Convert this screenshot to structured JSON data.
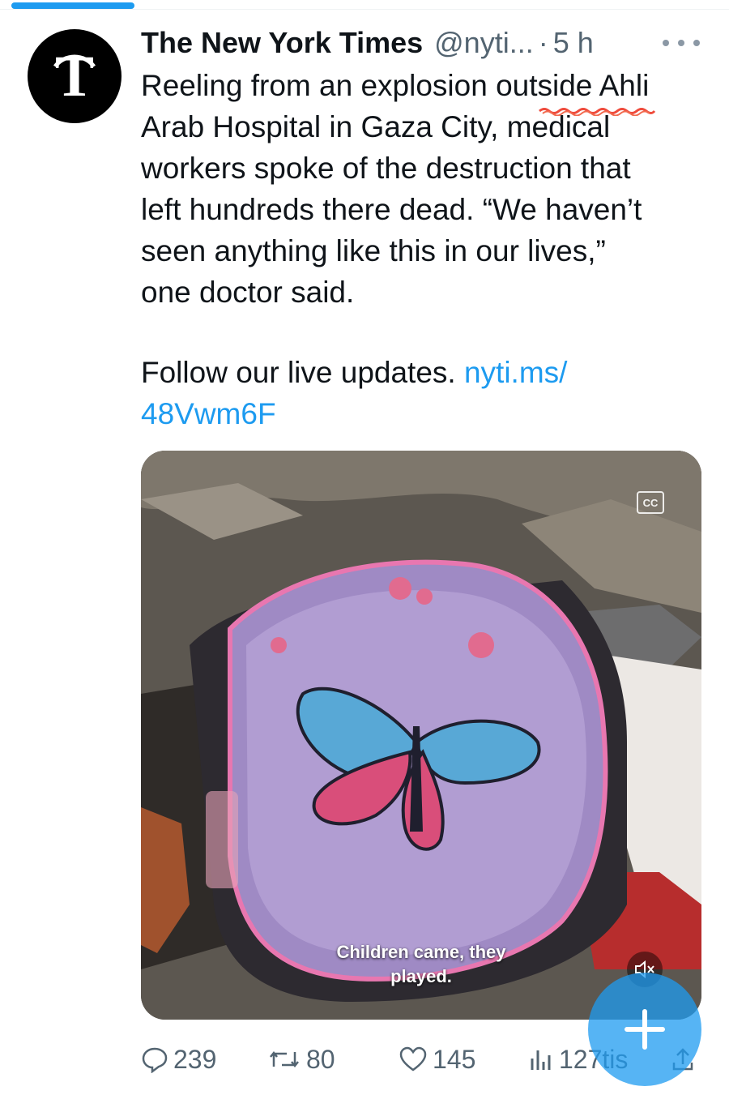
{
  "tweet": {
    "author_name": "The New York Times",
    "handle": "@nyti...",
    "separator": "·",
    "time": "5 h",
    "text_lines": [
      "Reeling from an explosion outside Ahli",
      "Arab Hospital in Gaza City, medical",
      "workers spoke of the destruction that",
      "left hundreds there dead. “We haven’t",
      "seen anything like this in our lives,”",
      "one doctor said."
    ],
    "follow_text": "Follow our live updates. ",
    "link_line1": "nyti.ms/",
    "link_line2": "48Vwm6F",
    "link_color": "#1d9bf0"
  },
  "media": {
    "cc_label": "CC",
    "caption_line1": "Children came, they",
    "caption_line2": "played."
  },
  "actions": {
    "replies": "239",
    "retweets": "80",
    "likes": "145",
    "views": "127tis"
  },
  "icons": {
    "avatar": "nyt-logo-icon",
    "more": "more-icon",
    "reply": "reply-icon",
    "retweet": "retweet-icon",
    "like": "heart-icon",
    "views": "views-icon",
    "share": "share-icon",
    "mute": "mute-icon",
    "compose": "plus-icon",
    "captions": "captions-icon"
  },
  "colors": {
    "accent": "#1d9bf0",
    "text": "#0f1419",
    "muted": "#536471"
  }
}
